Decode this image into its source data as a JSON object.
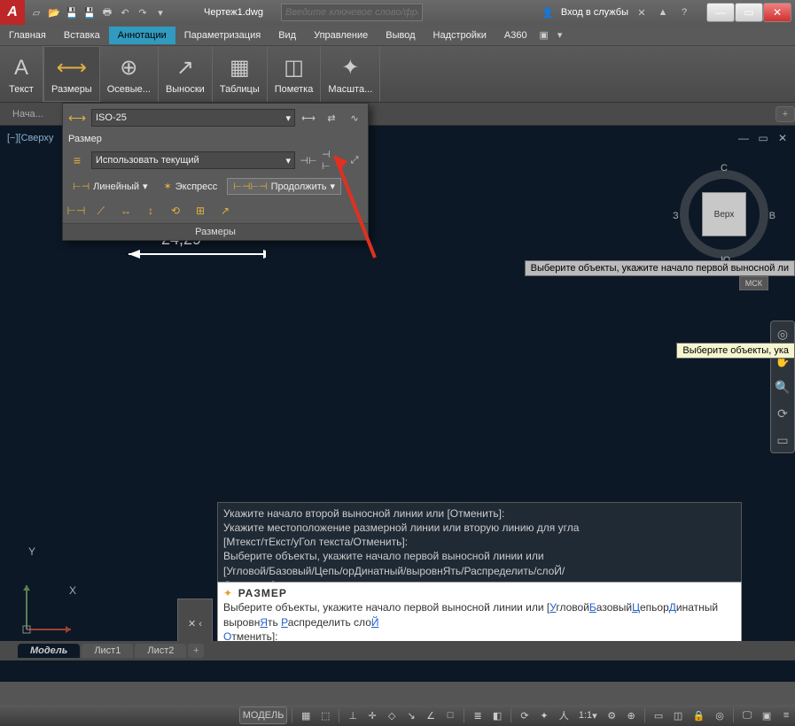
{
  "title": {
    "document": "Чертеж1.dwg",
    "search_placeholder": "Введите ключевое слово/фразу",
    "sign_in": "Вход в службы"
  },
  "win": {
    "min": "—",
    "max": "▭",
    "close": "✕"
  },
  "menu": [
    "Главная",
    "Вставка",
    "Аннотации",
    "Параметризация",
    "Вид",
    "Управление",
    "Вывод",
    "Надстройки",
    "A360"
  ],
  "menu_active": 2,
  "ribbon": [
    {
      "label": "Текст",
      "icon": "A"
    },
    {
      "label": "Размеры",
      "icon": "⟷"
    },
    {
      "label": "Осевые...",
      "icon": "⊕"
    },
    {
      "label": "Выноски",
      "icon": "↗"
    },
    {
      "label": "Таблицы",
      "icon": "▦"
    },
    {
      "label": "Пометка",
      "icon": "◫"
    },
    {
      "label": "Масшта...",
      "icon": "✦"
    }
  ],
  "ribbon_active": 1,
  "docbar": {
    "start": "Нача...",
    "add": "+"
  },
  "view_label": "[−][Сверху",
  "view_ctrls": {
    "min": "—",
    "max": "▭",
    "close": "✕"
  },
  "viewcube": {
    "top": "Верх",
    "n": "С",
    "e": "В",
    "s": "Ю",
    "w": "З"
  },
  "mck": "МСК",
  "dimension_text": "24,29",
  "tooltip1": "Выберите объекты, укажите начало первой выносной ли",
  "tooltip2": "Выберите объекты, ука",
  "cmd_history": {
    "l1": "Укажите начало второй выносной линии или [Отменить]:",
    "l2": "Укажите местоположение размерной линии или вторую линию для угла",
    "l3": "[Мтекст/тЕкст/уГол текста/Отменить]:",
    "l4": "Выберите объекты, укажите начало первой выносной линии или",
    "l5": "[Угловой/Базовый/Цепь/орДинатный/выровнЯть/Распределить/слоЙ/",
    "l6": "Отменить]:"
  },
  "cmd_input": {
    "cmd": "РАЗМЕР",
    "prompt_pre": "Выберите объекты, укажите начало первой выносной линии или [",
    "opts": [
      {
        "h": "У",
        "rest": "гловой"
      },
      {
        "h": "Б",
        "rest": "азовый"
      },
      {
        "h": "Ц",
        "rest": "епь"
      },
      {
        "h": "",
        "rest": "ор"
      },
      {
        "h": "Д",
        "rest": "инатный"
      },
      {
        "sep": " "
      },
      {
        "h": "",
        "rest": "выровн"
      },
      {
        "h": "Я",
        "rest": "ть"
      },
      {
        "sep": " "
      },
      {
        "h": "Р",
        "rest": "аспределить"
      },
      {
        "sep": " "
      },
      {
        "h": "",
        "rest": "сло"
      },
      {
        "h": "Й",
        "rest": ""
      }
    ],
    "prompt_post_line2": "Отменить]:",
    "cancel_h": "О",
    "cancel_rest": "тменить"
  },
  "cmd_handle": "✕ ‹",
  "model_tabs": [
    "Модель",
    "Лист1",
    "Лист2"
  ],
  "model_active": 0,
  "status": {
    "model": "МОДЕЛЬ",
    "scale": "1:1"
  },
  "dd": {
    "style": "ISO-25",
    "label_dim": "Размер",
    "layer": "Использовать текущий",
    "linear": "Линейный",
    "express": "Экспресс",
    "cont": "Продолжить",
    "title": "Размеры"
  },
  "ucs": {
    "x": "X",
    "y": "Y"
  }
}
